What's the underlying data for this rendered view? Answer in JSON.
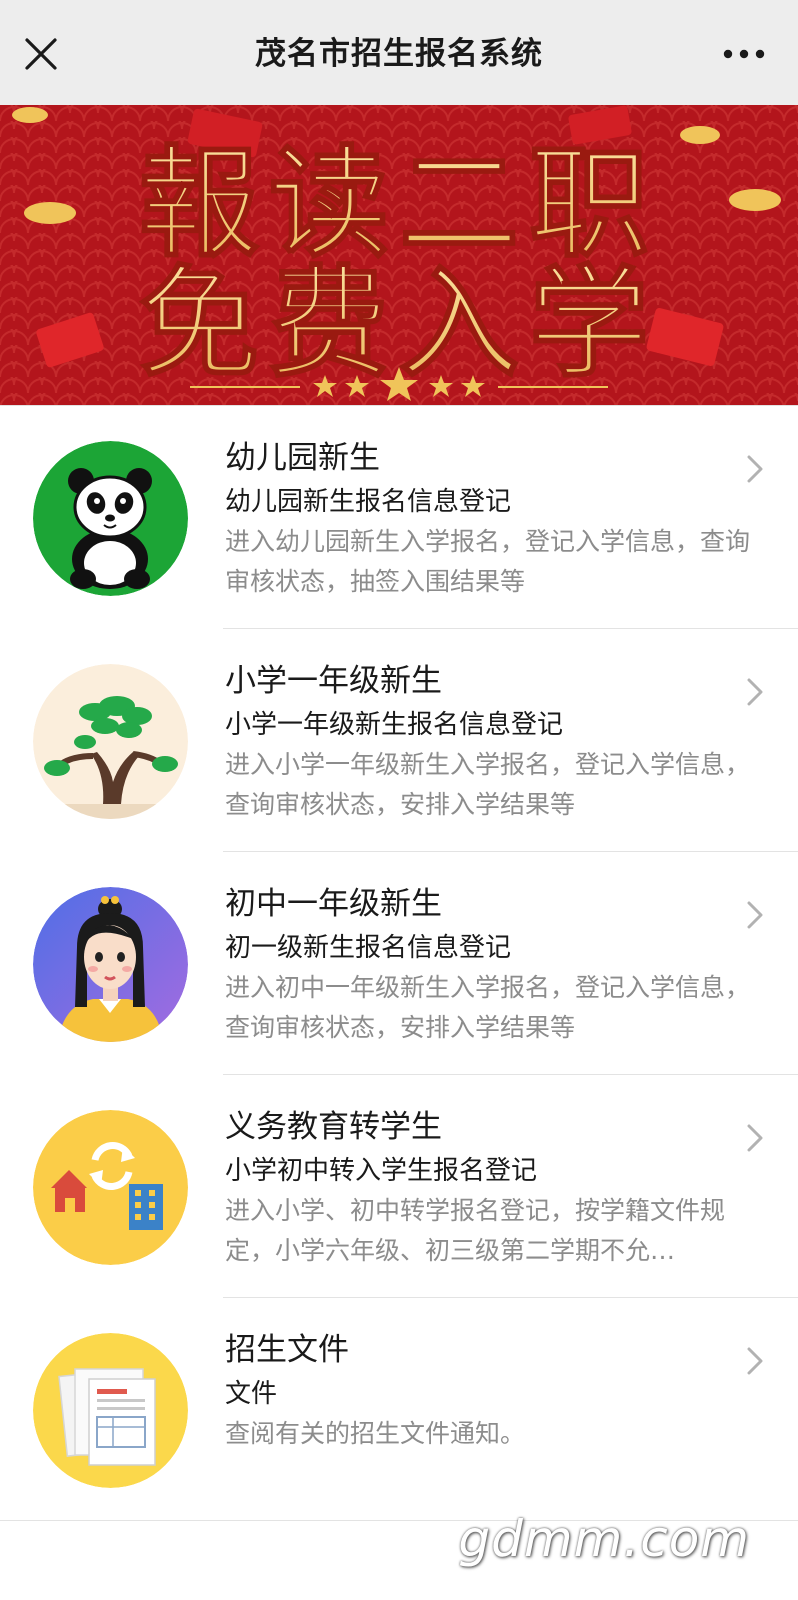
{
  "topbar": {
    "title": "茂名市招生报名系统",
    "close_icon": "close-icon",
    "more_icon": "more-dots-icon"
  },
  "banner": {
    "line1": "報读二职",
    "line2": "免费入学",
    "colors": {
      "bg": "#b2141b",
      "text": "#f3cf7a"
    }
  },
  "items": [
    {
      "title": "幼儿园新生",
      "subtitle": "幼儿园新生报名信息登记",
      "desc": "进入幼儿园新生入学报名，登记入学信息，查询审核状态，抽签入围结果等",
      "icon": "panda-icon"
    },
    {
      "title": "小学一年级新生",
      "subtitle": "小学一年级新生报名信息登记",
      "desc": "进入小学一年级新生入学报名，登记入学信息，查询审核状态，安排入学结果等",
      "icon": "tree-icon"
    },
    {
      "title": "初中一年级新生",
      "subtitle": "初一级新生报名信息登记",
      "desc": "进入初中一年级新生入学报名，登记入学信息，查询审核状态，安排入学结果等",
      "icon": "girl-avatar-icon"
    },
    {
      "title": "义务教育转学生",
      "subtitle": "小学初中转入学生报名登记",
      "desc": "进入小学、初中转学报名登记，按学籍文件规定，小学六年级、初三级第二学期不允…",
      "icon": "transfer-buildings-icon"
    },
    {
      "title": "招生文件",
      "subtitle": "文件",
      "desc": "查阅有关的招生文件通知。",
      "icon": "documents-icon"
    }
  ],
  "watermark": "gdmm.com"
}
